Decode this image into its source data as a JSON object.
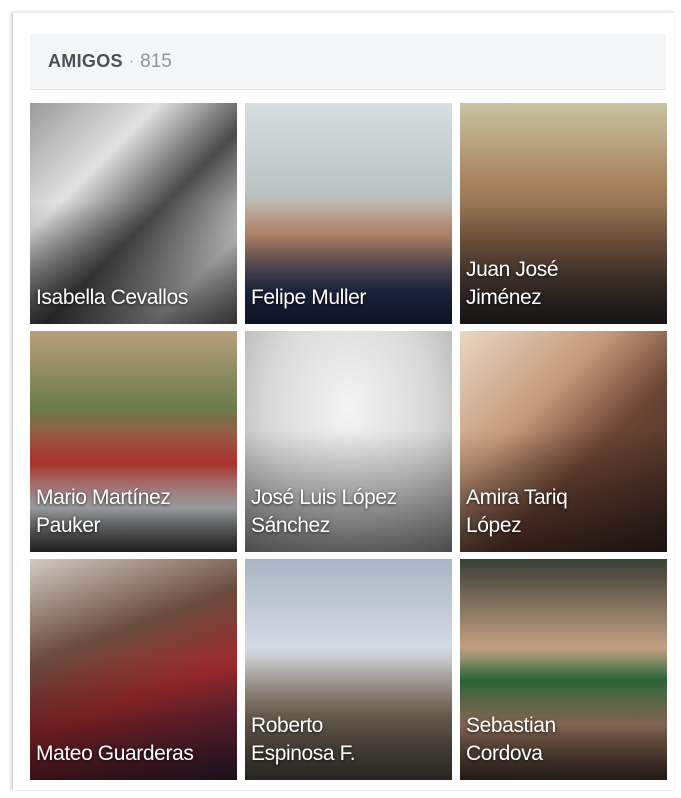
{
  "friends_section": {
    "title": "AMIGOS",
    "separator": "·",
    "count": "815"
  },
  "friends": [
    {
      "name": "Isabella Cevallos",
      "photo": "isabella-photo"
    },
    {
      "name": "Felipe Muller",
      "photo": "felipe-photo"
    },
    {
      "name": "Juan José Jiménez",
      "photo": "juan-photo"
    },
    {
      "name": "Mario Martínez Pauker",
      "photo": "mario-photo"
    },
    {
      "name": "José Luis López Sánchez",
      "photo": "jose-photo"
    },
    {
      "name": "Amira Tariq López",
      "photo": "amira-photo"
    },
    {
      "name": "Mateo Guarderas",
      "photo": "mateo-photo"
    },
    {
      "name": "Roberto Espinosa F.",
      "photo": "roberto-photo"
    },
    {
      "name": "Sebastian Cordova",
      "photo": "sebastian-photo"
    }
  ]
}
